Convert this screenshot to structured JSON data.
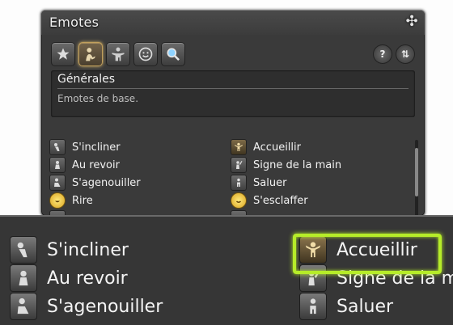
{
  "window": {
    "title": "Emotes",
    "close_icon": "close-icon"
  },
  "toolbar": {
    "tabs": [
      {
        "icon": "star-icon"
      },
      {
        "icon": "person-general-icon"
      },
      {
        "icon": "person-special-icon"
      },
      {
        "icon": "face-icon"
      },
      {
        "icon": "search-icon"
      }
    ],
    "help_label": "?",
    "sort_label": "⇅"
  },
  "category": {
    "title": "Générales",
    "description": "Emotes de base."
  },
  "emotes": {
    "left": [
      {
        "label": "S'incliner",
        "icon": "bow-icon"
      },
      {
        "label": "Au revoir",
        "icon": "goodbye-icon"
      },
      {
        "label": "S'agenouiller",
        "icon": "kneel-icon"
      },
      {
        "label": "Rire",
        "icon": "laugh-icon"
      }
    ],
    "right": [
      {
        "label": "Accueillir",
        "icon": "welcome-icon"
      },
      {
        "label": "Signe de la main",
        "icon": "wave-icon"
      },
      {
        "label": "Saluer",
        "icon": "salute-icon"
      },
      {
        "label": "S'esclaffer",
        "icon": "chuckle-icon"
      }
    ]
  },
  "zoom": {
    "left": [
      "S'incliner",
      "Au revoir",
      "S'agenouiller"
    ],
    "right": [
      "Accueillir",
      "Signe de la mai",
      "Saluer"
    ]
  },
  "colors": {
    "highlight": "#b6ec29",
    "window_bg": "#3a3a3a"
  }
}
